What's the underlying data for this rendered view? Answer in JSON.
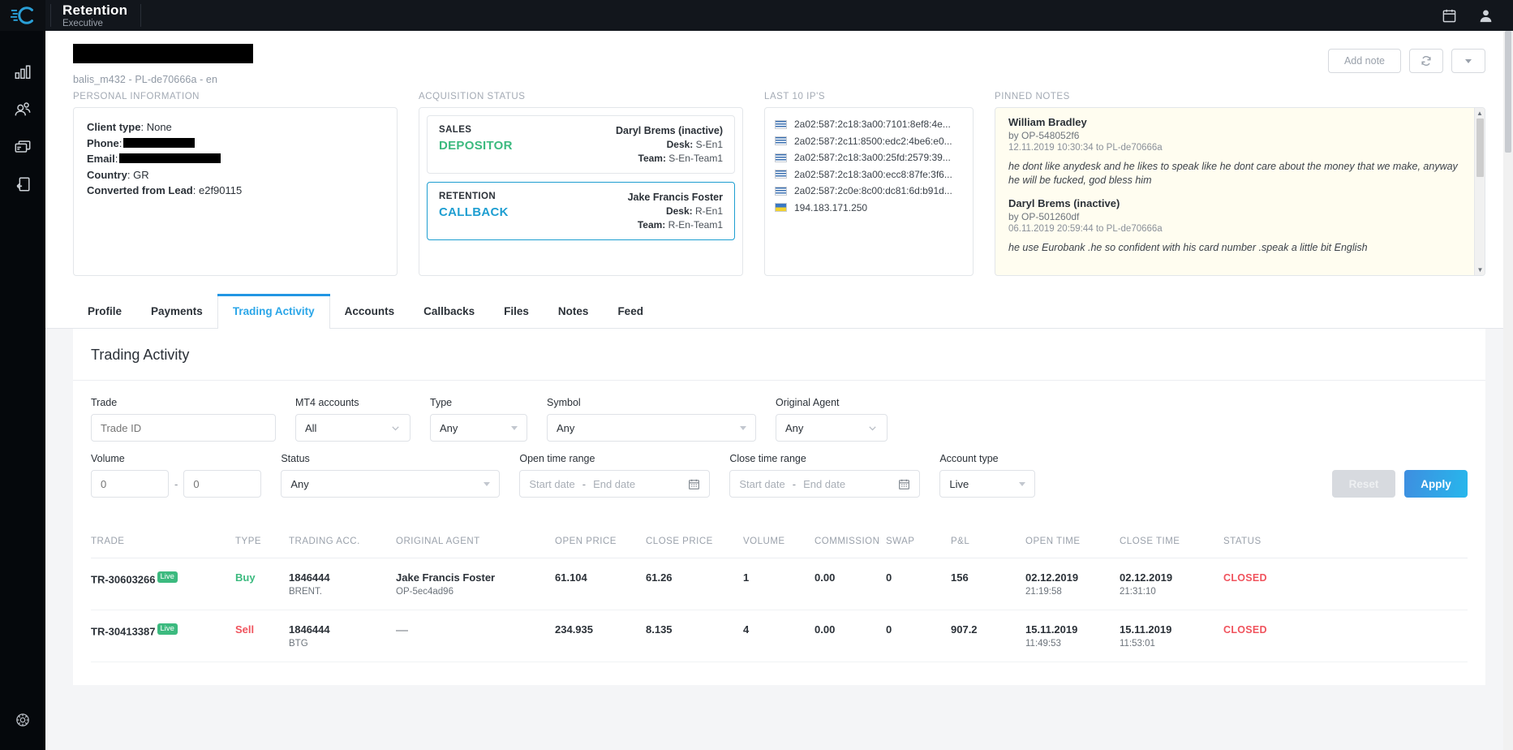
{
  "topbar": {
    "brand_title": "Retention",
    "brand_sub": "Executive",
    "calendar_icon": "calendar-icon",
    "user_icon": "user-icon"
  },
  "sidebar": {
    "items": [
      {
        "icon": "bar-chart-icon",
        "name": "dashboard"
      },
      {
        "icon": "users-icon",
        "name": "clients"
      },
      {
        "icon": "cards-icon",
        "name": "payments"
      },
      {
        "icon": "document-upload-icon",
        "name": "documents"
      }
    ],
    "bottom_icon": "settings-gear-icon"
  },
  "profile": {
    "name_redacted": true,
    "uid": "balis_m432 - PL-de70666a - en",
    "add_note_label": "Add note",
    "refresh_icon": "refresh-icon",
    "more_icon": "chevron-down-icon"
  },
  "personal_information": {
    "label": "Personal information",
    "rows": [
      {
        "key": "Client type",
        "value": "None",
        "redacted": false
      },
      {
        "key": "Phone",
        "value": "",
        "redacted": true
      },
      {
        "key": "Email",
        "value": "",
        "redacted": true
      },
      {
        "key": "Country",
        "value": "GR",
        "redacted": false
      },
      {
        "key": "Converted from Lead",
        "value": "e2f90115",
        "redacted": false
      }
    ]
  },
  "acquisition_status": {
    "label": "Acquisition status",
    "boxes": [
      {
        "kind": "SALES",
        "status": "DEPOSITOR",
        "status_color": "#3cba7f",
        "agent": "Daryl Brems (inactive)",
        "desk_label": "Desk:",
        "desk": "S-En1",
        "team_label": "Team:",
        "team": "S-En-Team1",
        "active": false
      },
      {
        "kind": "RETENTION",
        "status": "CALLBACK",
        "status_color": "#1e9ed1",
        "agent": "Jake Francis Foster",
        "desk_label": "Desk:",
        "desk": "R-En1",
        "team_label": "Team:",
        "team": "R-En-Team1",
        "active": true
      }
    ]
  },
  "last_ips": {
    "label": "Last 10 IP's",
    "items": [
      {
        "flag": "greece-flag",
        "ip": "2a02:587:2c18:3a00:7101:8ef8:4e..."
      },
      {
        "flag": "greece-flag",
        "ip": "2a02:587:2c11:8500:edc2:4be6:e0..."
      },
      {
        "flag": "greece-flag",
        "ip": "2a02:587:2c18:3a00:25fd:2579:39..."
      },
      {
        "flag": "greece-flag",
        "ip": "2a02:587:2c18:3a00:ecc8:87fe:3f6..."
      },
      {
        "flag": "greece-flag",
        "ip": "2a02:587:2c0e:8c00:dc81:6d:b91d..."
      },
      {
        "flag": "ukraine-flag",
        "ip": "194.183.171.250"
      }
    ]
  },
  "pinned_notes": {
    "label": "Pinned notes",
    "notes": [
      {
        "author": "William Bradley",
        "by": "by OP-548052f6",
        "date": "12.11.2019 10:30:34 to PL-de70666a",
        "body": "he dont like anydesk and he likes to speak like he dont care about the money that we make, anyway he will be fucked, god bless him"
      },
      {
        "author": "Daryl Brems (inactive)",
        "by": "by OP-501260df",
        "date": "06.11.2019 20:59:44 to PL-de70666a",
        "body": "he use Eurobank .he so confident with his card number .speak a little bit English"
      }
    ]
  },
  "tabs": {
    "items": [
      {
        "label": "Profile",
        "active": false
      },
      {
        "label": "Payments",
        "active": false
      },
      {
        "label": "Trading Activity",
        "active": true
      },
      {
        "label": "Accounts",
        "active": false
      },
      {
        "label": "Callbacks",
        "active": false
      },
      {
        "label": "Files",
        "active": false
      },
      {
        "label": "Notes",
        "active": false
      },
      {
        "label": "Feed",
        "active": false
      }
    ]
  },
  "content": {
    "title": "Trading Activity"
  },
  "filters": {
    "trade": {
      "label": "Trade",
      "placeholder": "Trade ID",
      "value": ""
    },
    "mt4_accounts": {
      "label": "MT4 accounts",
      "value": "All"
    },
    "type": {
      "label": "Type",
      "value": "Any"
    },
    "symbol": {
      "label": "Symbol",
      "value": "Any"
    },
    "original_agent": {
      "label": "Original Agent",
      "value": "Any"
    },
    "volume": {
      "label": "Volume",
      "from": "0",
      "to": "0",
      "separator": "-"
    },
    "status": {
      "label": "Status",
      "value": "Any"
    },
    "open_time_range": {
      "label": "Open time range",
      "start_placeholder": "Start date",
      "end_placeholder": "End date",
      "separator": "-",
      "icon": "calendar-icon"
    },
    "close_time_range": {
      "label": "Close time range",
      "start_placeholder": "Start date",
      "end_placeholder": "End date",
      "separator": "-",
      "icon": "calendar-icon"
    },
    "account_type": {
      "label": "Account type",
      "value": "Live"
    },
    "reset_label": "Reset",
    "apply_label": "Apply"
  },
  "table": {
    "headers": [
      "Trade",
      "Type",
      "Trading acc.",
      "Original agent",
      "Open price",
      "Close price",
      "Volume",
      "Commission",
      "Swap",
      "P&L",
      "Open time",
      "Close time",
      "Status"
    ],
    "rows": [
      {
        "trade": "TR-30603266",
        "badge": "Live",
        "type": "Buy",
        "type_color": "#3cba7f",
        "acc": "1846444",
        "acc_sub": "BRENT.",
        "agent": "Jake Francis Foster",
        "agent_sub": "OP-5ec4ad96",
        "open_price": "61.104",
        "close_price": "61.26",
        "volume": "1",
        "commission": "0.00",
        "swap": "0",
        "pl": "156",
        "open_date": "02.12.2019",
        "open_time": "21:19:58",
        "close_date": "02.12.2019",
        "close_time": "21:31:10",
        "status": "CLOSED"
      },
      {
        "trade": "TR-30413387",
        "badge": "Live",
        "type": "Sell",
        "type_color": "#f0535d",
        "acc": "1846444",
        "acc_sub": "BTG",
        "agent": "—",
        "agent_sub": "",
        "open_price": "234.935",
        "close_price": "8.135",
        "volume": "4",
        "commission": "0.00",
        "swap": "0",
        "pl": "907.2",
        "open_date": "15.11.2019",
        "open_time": "11:49:53",
        "close_date": "15.11.2019",
        "close_time": "11:53:01",
        "status": "CLOSED"
      }
    ]
  },
  "colors": {
    "accent_blue": "#2196e3",
    "green": "#3cba7f",
    "red": "#f0535d",
    "dark_bg": "#12161c"
  }
}
